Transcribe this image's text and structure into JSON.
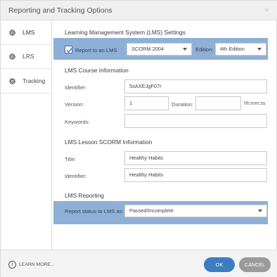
{
  "window": {
    "title": "Reporting and Tracking Options",
    "close_glyph": "×"
  },
  "sidebar": {
    "items": [
      {
        "label": "LMS",
        "icon": "gear-icon",
        "active": true
      },
      {
        "label": "LRS",
        "icon": "gear-icon",
        "active": false
      },
      {
        "label": "Tracking",
        "icon": "gear-icon",
        "active": false
      }
    ]
  },
  "lms_settings": {
    "heading": "Learning Management System (LMS) Settings",
    "report_checkbox_label": "Report to an LMS",
    "report_checked": true,
    "standard_value": "SCORM 2004",
    "edition_label": "Edition:",
    "edition_value": "4th Edition"
  },
  "course_info": {
    "heading": "LMS Course Information",
    "identifier_label": "Identifier:",
    "identifier_value": "5sAXEJgF07r",
    "version_label": "Version:",
    "version_value": "1",
    "duration_label": "Duration:",
    "duration_value": "",
    "duration_unit": "hh:mm:ss",
    "keywords_label": "Keywords:",
    "keywords_value": ""
  },
  "lesson_info": {
    "heading": "LMS Lesson SCORM Information",
    "title_label": "Title:",
    "title_value": "Healthy Habits",
    "identifier_label": "Identifier:",
    "identifier_value": "Healthy Habits"
  },
  "reporting": {
    "heading": "LMS Reporting",
    "status_label": "Report status to LMS as:",
    "status_value": "Passed/Incomplete"
  },
  "footer": {
    "learn_more": "LEARN MORE...",
    "info_glyph": "i",
    "ok_label": "OK",
    "cancel_label": "CANCEL"
  },
  "colors": {
    "highlight": "#8fb0d6",
    "ok_button": "#3e7cc1",
    "cancel_button": "#9a9a9a"
  }
}
